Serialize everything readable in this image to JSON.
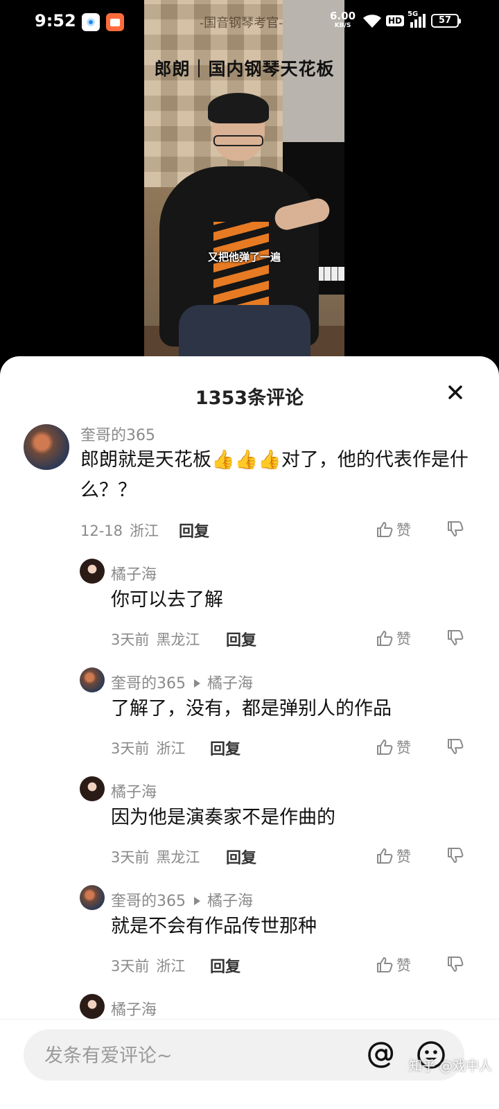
{
  "status_bar": {
    "time": "9:52",
    "net_speed": "6.00",
    "net_unit": "KB/S",
    "hd": "HD",
    "network": "5G",
    "battery": "57"
  },
  "video": {
    "subtitle": "-国音钢琴考官-",
    "title": "郎朗｜国内钢琴天花板",
    "caption": "又把他弹了一遍"
  },
  "comments_sheet": {
    "title": "1353条评论",
    "reply_label": "回复",
    "like_label": "赞",
    "comments": [
      {
        "author": "奎哥的365",
        "text": "郎朗就是天花板👍👍👍对了，他的代表作是什么？？",
        "time": "12-18",
        "location": "浙江"
      },
      {
        "author": "橘子海",
        "text": "你可以去了解",
        "time": "3天前",
        "location": "黑龙江"
      },
      {
        "author": "奎哥的365",
        "reply_to": "橘子海",
        "text": "了解了，没有，都是弹别人的作品",
        "time": "3天前",
        "location": "浙江"
      },
      {
        "author": "橘子海",
        "text": "因为他是演奏家不是作曲的",
        "time": "3天前",
        "location": "黑龙江"
      },
      {
        "author": "奎哥的365",
        "reply_to": "橘子海",
        "text": "就是不会有作品传世那种",
        "time": "3天前",
        "location": "浙江"
      },
      {
        "author": "橘子海"
      }
    ]
  },
  "input_bar": {
    "placeholder": "发条有爱评论~",
    "watermark": "知乎 @戏中人"
  }
}
